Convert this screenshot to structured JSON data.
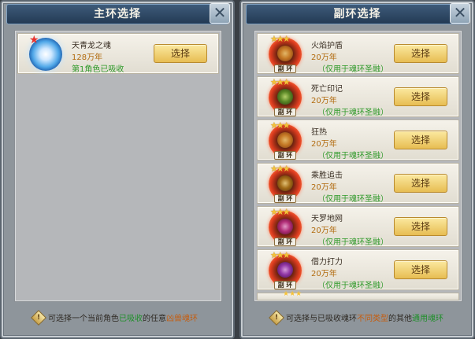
{
  "main_panel": {
    "title": "主环选择",
    "items": [
      {
        "name": "天青龙之魂",
        "cost": "128万年",
        "note": "第1角色已吸收",
        "button": "选择"
      }
    ],
    "footer": {
      "prefix": "可选择一个当前角色",
      "hl1": "已吸收",
      "middle": "的任意",
      "hl2": "凶兽魂环"
    }
  },
  "sub_panel": {
    "title": "副环选择",
    "badge": "副 环",
    "items": [
      {
        "name": "火焰护盾",
        "cost": "20万年",
        "note": "（仅用于魂环圣融）",
        "button": "选择"
      },
      {
        "name": "死亡印记",
        "cost": "20万年",
        "note": "（仅用于魂环圣融）",
        "button": "选择"
      },
      {
        "name": "狂热",
        "cost": "20万年",
        "note": "（仅用于魂环圣融）",
        "button": "选择"
      },
      {
        "name": "乘胜追击",
        "cost": "20万年",
        "note": "（仅用于魂环圣融）",
        "button": "选择"
      },
      {
        "name": "天罗地网",
        "cost": "20万年",
        "note": "（仅用于魂环圣融）",
        "button": "选择"
      },
      {
        "name": "借力打力",
        "cost": "20万年",
        "note": "（仅用于魂环圣融）",
        "button": "选择"
      }
    ],
    "footer": {
      "prefix": "可选择与已吸收魂环",
      "hl1": "不同类型",
      "middle": "的其他",
      "hl2": "通用魂环"
    }
  },
  "icons": {
    "close": "close-icon",
    "tip": "tip-icon",
    "star": "star-icon"
  },
  "colors": {
    "title_bar": "#2f4a66",
    "button": "#e7bd52",
    "cost": "#b26c10",
    "note": "#2f9a2a"
  }
}
